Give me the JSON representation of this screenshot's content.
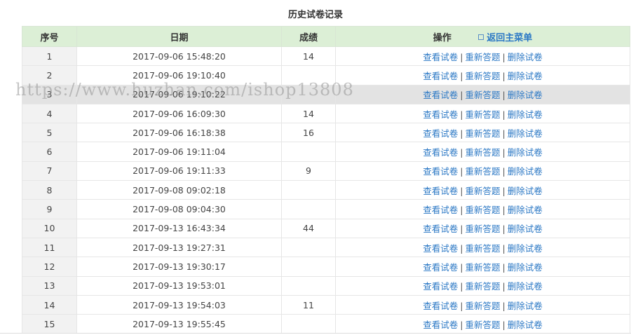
{
  "page": {
    "title": "历史试卷记录"
  },
  "table": {
    "headers": {
      "seq": "序号",
      "date": "日期",
      "score": "成绩",
      "ops": "操作"
    },
    "return_link": "返回主菜单",
    "action_labels": {
      "view": "查看试卷",
      "redo": "重新答题",
      "delete": "删除试卷",
      "separator": "|"
    },
    "rows": [
      {
        "seq": "1",
        "date": "2017-09-06 15:48:20",
        "score": "14"
      },
      {
        "seq": "2",
        "date": "2017-09-06 19:10:40",
        "score": ""
      },
      {
        "seq": "3",
        "date": "2017-09-06 19:10:22",
        "score": ""
      },
      {
        "seq": "4",
        "date": "2017-09-06 16:09:30",
        "score": "14"
      },
      {
        "seq": "5",
        "date": "2017-09-06 16:18:38",
        "score": "16"
      },
      {
        "seq": "6",
        "date": "2017-09-06 19:11:04",
        "score": ""
      },
      {
        "seq": "7",
        "date": "2017-09-06 19:11:33",
        "score": "9"
      },
      {
        "seq": "8",
        "date": "2017-09-08 09:02:18",
        "score": ""
      },
      {
        "seq": "9",
        "date": "2017-09-08 09:04:30",
        "score": ""
      },
      {
        "seq": "10",
        "date": "2017-09-13 16:43:34",
        "score": "44"
      },
      {
        "seq": "11",
        "date": "2017-09-13 19:27:31",
        "score": ""
      },
      {
        "seq": "12",
        "date": "2017-09-13 19:30:17",
        "score": ""
      },
      {
        "seq": "13",
        "date": "2017-09-13 19:53:01",
        "score": ""
      },
      {
        "seq": "14",
        "date": "2017-09-13 19:54:03",
        "score": "11"
      },
      {
        "seq": "15",
        "date": "2017-09-13 19:55:45",
        "score": ""
      }
    ]
  },
  "watermark": "https://www.huzhan.com/ishop13808",
  "colors": {
    "header_bg": "#dcefd6",
    "link": "#2b78c5",
    "seq_bg": "#f2f2f2",
    "hover_row_bg": "#e3e3e3"
  }
}
